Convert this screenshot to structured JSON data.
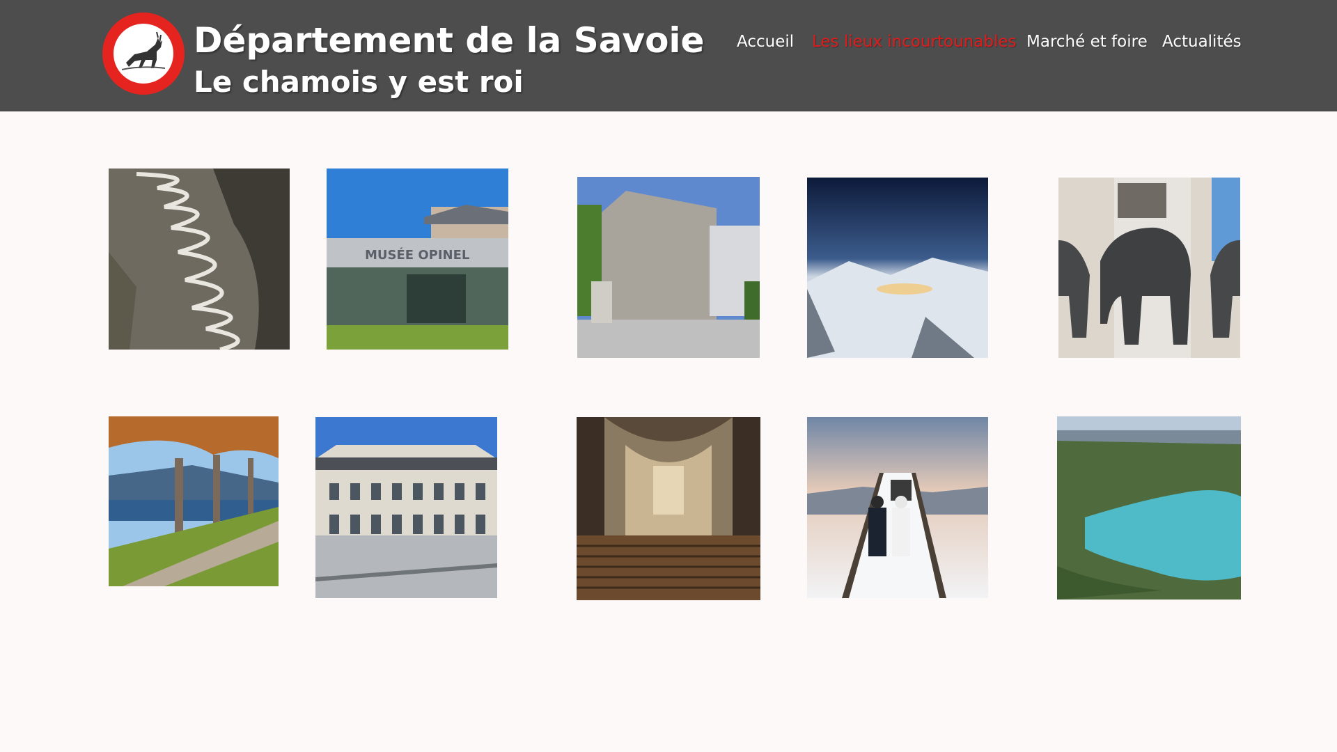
{
  "header": {
    "title": "Département de la Savoie",
    "subtitle": "Le chamois y est roi",
    "logo_icon": "chamois-icon",
    "colors": {
      "bar": "#4d4d4d",
      "logo_ring": "#e52420",
      "active_link": "#e01b1b"
    }
  },
  "nav": {
    "items": [
      {
        "label": "Accueil",
        "active": false
      },
      {
        "label": "Les lieux incourtounables",
        "active": true
      },
      {
        "label": "Marché et foire",
        "active": false
      },
      {
        "label": "Actualités",
        "active": false
      }
    ]
  },
  "gallery": {
    "row1": [
      {
        "subject": "mountain serpentine road"
      },
      {
        "subject": "Opinel museum",
        "sign": "MUSÉE OPINEL"
      },
      {
        "subject": "castle of the Dukes of Savoy"
      },
      {
        "subject": "night over snowy valley"
      },
      {
        "subject": "elephant fountain"
      }
    ],
    "row2": [
      {
        "subject": "lakeside promenade with plane trees"
      },
      {
        "subject": "grand building on square"
      },
      {
        "subject": "cathedral interior"
      },
      {
        "subject": "couple on snowy footbridge"
      },
      {
        "subject": "turquoise lake aerial view"
      }
    ]
  }
}
